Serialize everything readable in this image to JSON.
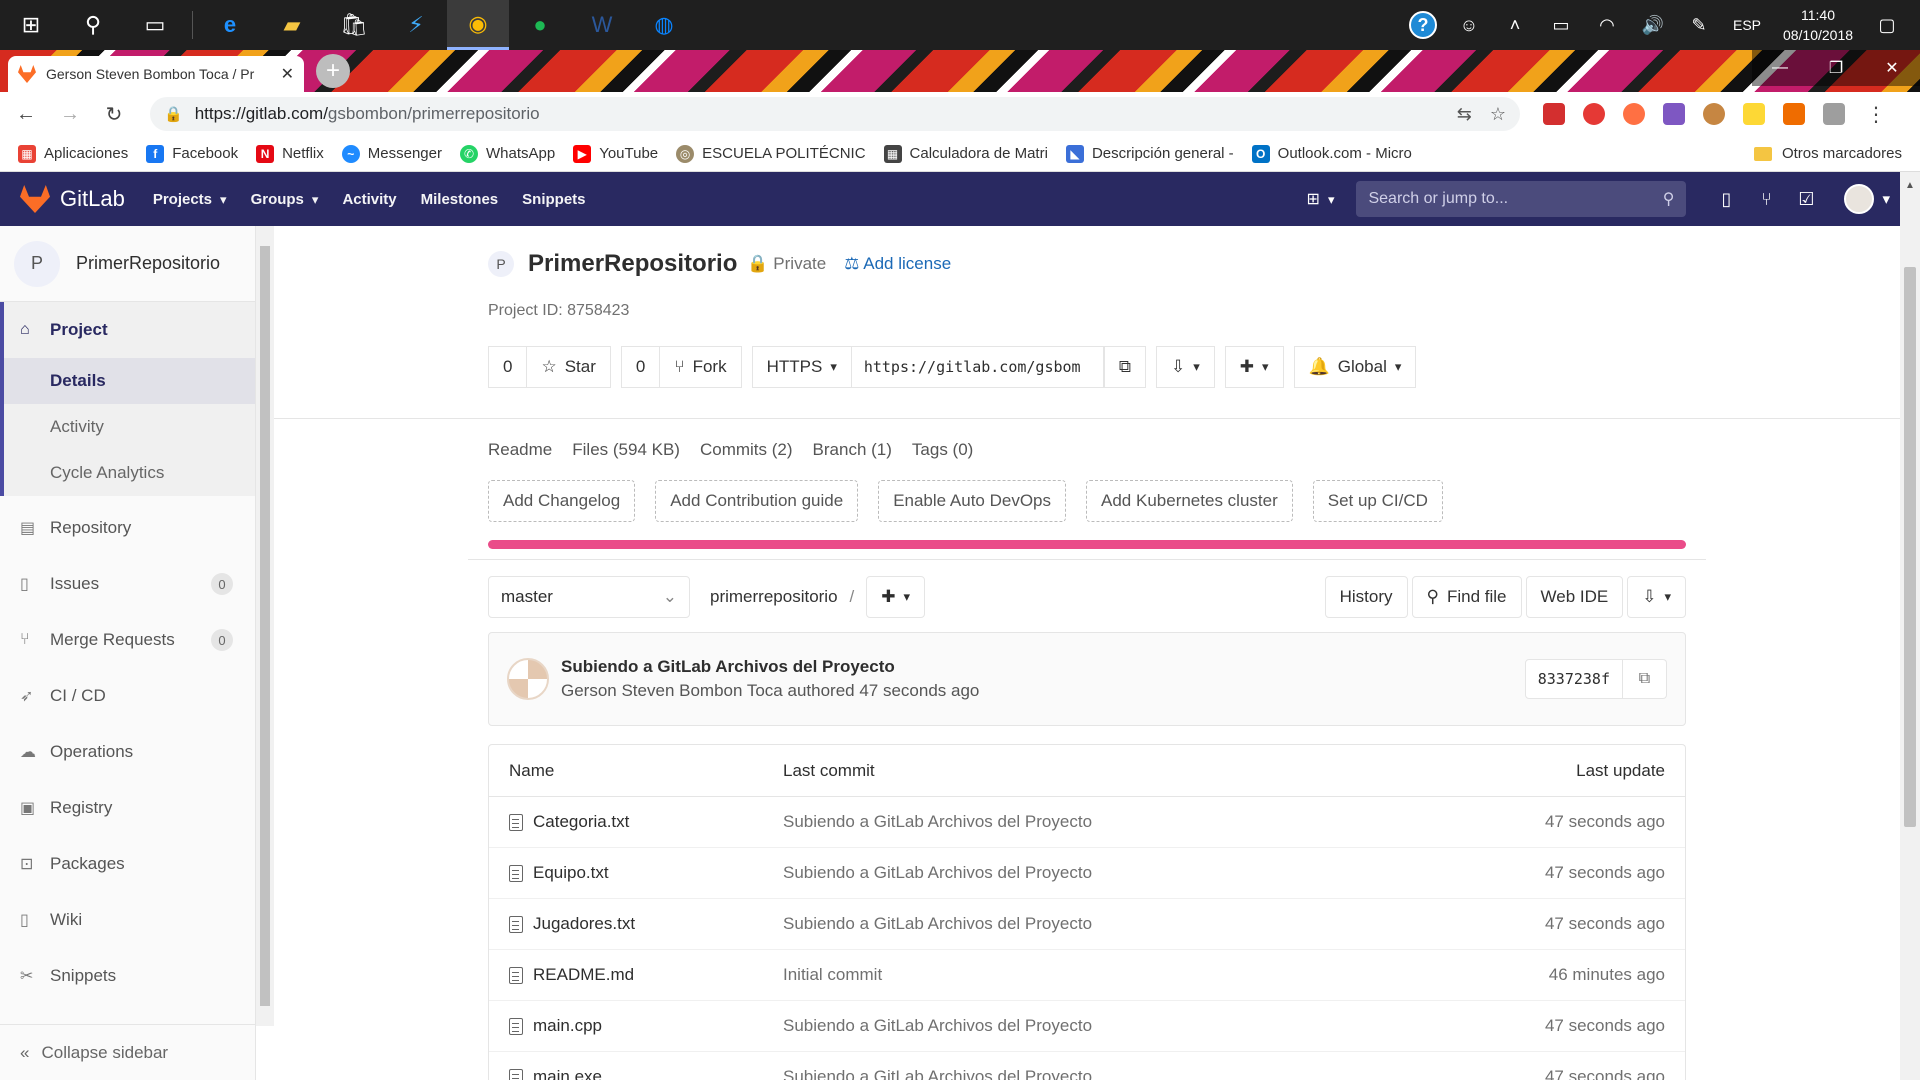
{
  "taskbar": {
    "clock_time": "11:40",
    "clock_date": "08/10/2018",
    "language": "ESP",
    "icons": [
      "windows-start-icon",
      "search-icon",
      "task-view-icon",
      "edge-icon",
      "file-explorer-icon",
      "store-icon",
      "visual-studio-icon",
      "chrome-icon",
      "spotify-icon",
      "word-icon",
      "maps-icon"
    ]
  },
  "browser": {
    "tab_title": "Gerson Steven Bombon Toca / Pr",
    "url_host": "https://gitlab.com/",
    "url_path": "gsbombon/primerrepositorio",
    "bookmarks": [
      {
        "label": "Aplicaciones",
        "color": "#e94235",
        "icon": "apps-icon"
      },
      {
        "label": "Facebook",
        "color": "#1877f2",
        "icon": "facebook-icon"
      },
      {
        "label": "Netflix",
        "color": "#e50914",
        "icon": "netflix-icon"
      },
      {
        "label": "Messenger",
        "color": "#1f8bff",
        "icon": "messenger-icon"
      },
      {
        "label": "WhatsApp",
        "color": "#25d366",
        "icon": "whatsapp-icon"
      },
      {
        "label": "YouTube",
        "color": "#ff0000",
        "icon": "youtube-icon"
      },
      {
        "label": "ESCUELA POLITÉCNIC",
        "color": "#9b8b6a",
        "icon": "epn-icon"
      },
      {
        "label": "Calculadora de Matri",
        "color": "#444444",
        "icon": "calculator-icon"
      },
      {
        "label": "Descripción general -",
        "color": "#3b6fd8",
        "icon": "azure-icon"
      },
      {
        "label": "Outlook.com - Micro",
        "color": "#0072c6",
        "icon": "outlook-icon"
      }
    ],
    "other_bookmarks": "Otros marcadores"
  },
  "gitlab_header": {
    "brand": "GitLab",
    "nav": [
      "Projects",
      "Groups",
      "Activity",
      "Milestones",
      "Snippets"
    ],
    "search_placeholder": "Search or jump to..."
  },
  "sidebar": {
    "project_initial": "P",
    "project_name": "PrimerRepositorio",
    "project_section": "Project",
    "project_sub": [
      "Details",
      "Activity",
      "Cycle Analytics"
    ],
    "items": [
      {
        "label": "Repository",
        "icon": "doc-icon"
      },
      {
        "label": "Issues",
        "icon": "issues-icon",
        "count": "0"
      },
      {
        "label": "Merge Requests",
        "icon": "merge-request-icon",
        "count": "0"
      },
      {
        "label": "CI / CD",
        "icon": "rocket-icon"
      },
      {
        "label": "Operations",
        "icon": "cloud-gear-icon"
      },
      {
        "label": "Registry",
        "icon": "registry-icon"
      },
      {
        "label": "Packages",
        "icon": "package-icon"
      },
      {
        "label": "Wiki",
        "icon": "book-icon"
      },
      {
        "label": "Snippets",
        "icon": "scissors-icon"
      }
    ],
    "collapse_label": "Collapse sidebar"
  },
  "project": {
    "initial": "P",
    "name": "PrimerRepositorio",
    "visibility": "Private",
    "add_license": "Add license",
    "project_id": "Project ID: 8758423",
    "star_count": "0",
    "star_label": "Star",
    "fork_count": "0",
    "fork_label": "Fork",
    "clone_protocol": "HTTPS",
    "clone_url": "https://gitlab.com/gsbom",
    "notification": "Global",
    "stats": [
      "Readme",
      "Files (594 KB)",
      "Commits (2)",
      "Branch (1)",
      "Tags (0)"
    ],
    "quick_actions": [
      "Add Changelog",
      "Add Contribution guide",
      "Enable Auto DevOps",
      "Add Kubernetes cluster",
      "Set up CI/CD"
    ],
    "language_color": "#ea4c89"
  },
  "tree": {
    "branch": "master",
    "path_root": "primerrepositorio",
    "separator": "/",
    "buttons": [
      "History",
      "Find file",
      "Web IDE"
    ]
  },
  "last_commit": {
    "title": "Subiendo a GitLab Archivos del Proyecto",
    "meta": "Gerson Steven Bombon Toca authored 47 seconds ago",
    "sha": "8337238f"
  },
  "files": {
    "headers": {
      "name": "Name",
      "commit": "Last commit",
      "date": "Last update"
    },
    "rows": [
      {
        "name": "Categoria.txt",
        "commit": "Subiendo a GitLab Archivos del Proyecto",
        "date": "47 seconds ago"
      },
      {
        "name": "Equipo.txt",
        "commit": "Subiendo a GitLab Archivos del Proyecto",
        "date": "47 seconds ago"
      },
      {
        "name": "Jugadores.txt",
        "commit": "Subiendo a GitLab Archivos del Proyecto",
        "date": "47 seconds ago"
      },
      {
        "name": "README.md",
        "commit": "Initial commit",
        "date": "46 minutes ago"
      },
      {
        "name": "main.cpp",
        "commit": "Subiendo a GitLab Archivos del Proyecto",
        "date": "47 seconds ago"
      },
      {
        "name": "main.exe",
        "commit": "Subiendo a GitLab Archivos del Proyecto",
        "date": "47 seconds ago"
      }
    ]
  }
}
